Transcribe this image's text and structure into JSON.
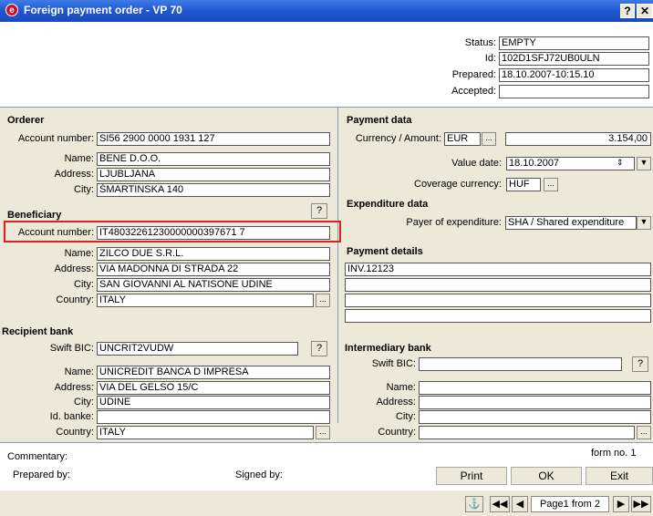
{
  "window": {
    "title": "Foreign payment order - VP 70",
    "help_glyph": "?",
    "close_glyph": "✕",
    "app_glyph": "e"
  },
  "header": {
    "status_label": "Status:",
    "status": "EMPTY",
    "id_label": "Id:",
    "id": "102D1SFJ72UB0ULN",
    "prepared_label": "Prepared:",
    "prepared": "18.10.2007-10:15.10",
    "accepted_label": "Accepted:",
    "accepted": ""
  },
  "orderer": {
    "title": "Orderer",
    "account_label": "Account number:",
    "account": "SI56 2900 0000 1931 127",
    "name_label": "Name:",
    "name": "BENE D.O.O.",
    "address_label": "Address:",
    "address": "LJUBLJANA",
    "city_label": "City:",
    "city": "ŠMARTINSKA 140"
  },
  "beneficiary": {
    "title": "Beneficiary",
    "help": "?",
    "account_label": "Account number:",
    "account": "IT48032261230000000397671 7",
    "name_label": "Name:",
    "name": "ZILCO DUE S.R.L.",
    "address_label": "Address:",
    "address": "VIA MADONNA DI STRADA 22",
    "city_label": "City:",
    "city": "SAN GIOVANNI AL NATISONE UDINE",
    "country_label": "Country:",
    "country": "ITALY",
    "lookup": "..."
  },
  "recipient_bank": {
    "title": "Recipient bank",
    "swift_label": "Swift BIC:",
    "swift": "UNCRIT2VUDW",
    "help": "?",
    "name_label": "Name:",
    "name": "UNICREDIT BANCA D IMPRESA",
    "address_label": "Address:",
    "address": "VIA DEL GELSO 15/C",
    "city_label": "City:",
    "city": "UDINE",
    "idbank_label": "Id. banke:",
    "idbank": "",
    "country_label": "Country:",
    "country": "ITALY",
    "lookup": "..."
  },
  "payment_data": {
    "title": "Payment data",
    "currency_label": "Currency / Amount:",
    "currency": "EUR",
    "lookup": "...",
    "amount": "3.154,00",
    "value_date_label": "Value date:",
    "value_date": "18.10.2007",
    "coverage_label": "Coverage currency:",
    "coverage": "HUF"
  },
  "expenditure": {
    "title": "Expenditure data",
    "payer_label": "Payer of expenditure:",
    "payer": "SHA / Shared expenditure"
  },
  "payment_details": {
    "title": "Payment details",
    "lines": [
      "INV.12123",
      "",
      "",
      ""
    ]
  },
  "intermediary": {
    "title": "Intermediary bank",
    "swift_label": "Swift BIC:",
    "swift": "",
    "help": "?",
    "name_label": "Name:",
    "address_label": "Address:",
    "city_label": "City:",
    "country_label": "Country:",
    "lookup": "..."
  },
  "footer": {
    "commentary_label": "Commentary:",
    "form_no": "form no. 1",
    "prepared_by_label": "Prepared by:",
    "signed_by_label": "Signed by:",
    "print": "Print",
    "ok": "OK",
    "exit": "Exit"
  },
  "pager": {
    "info": "Page1 from 2",
    "first": "◀◀",
    "prev": "◀",
    "next": "▶",
    "last": "▶▶",
    "tool": "⚓"
  }
}
